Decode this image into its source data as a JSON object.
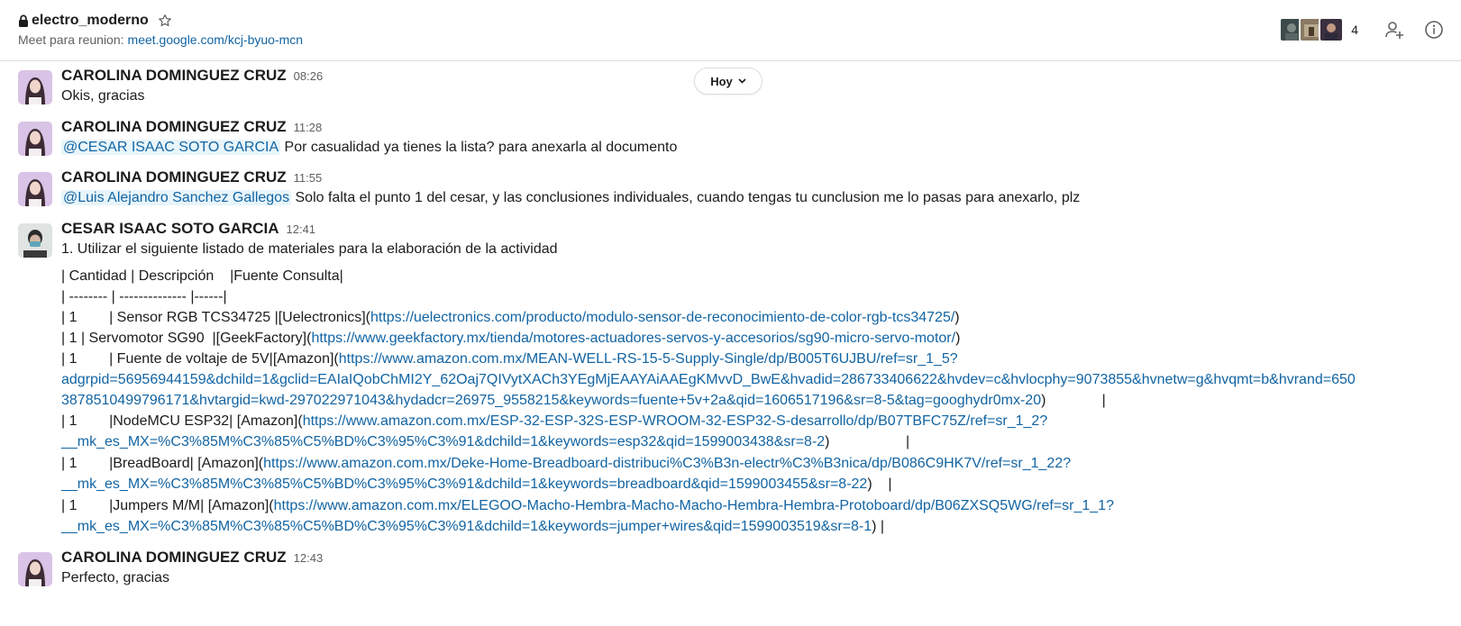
{
  "channel": {
    "name": "electro_moderno",
    "topic_label": "Meet para reunion:",
    "topic_link": "meet.google.com/kcj-byuo-mcn",
    "member_count": "4"
  },
  "day_divider": {
    "label": "Hoy"
  },
  "messages": [
    {
      "author": "CAROLINA DOMINGUEZ CRUZ",
      "time": "08:26",
      "text": "Okis,  gracias"
    },
    {
      "author": "CAROLINA DOMINGUEZ CRUZ",
      "time": "11:28",
      "mention": "@CESAR ISAAC SOTO GARCIA",
      "text": " Por casualidad ya tienes la lista? para anexarla al documento"
    },
    {
      "author": "CAROLINA DOMINGUEZ CRUZ",
      "time": "11:55",
      "mention": "@Luis Alejandro Sanchez Gallegos",
      "text": " Solo falta el punto 1 del cesar, y las conclusiones individuales, cuando tengas tu cunclusion me lo pasas para anexarlo, plz"
    },
    {
      "author": "CESAR ISAAC SOTO GARCIA",
      "time": "12:41",
      "text": "1. Utilizar el siguiente listado de materiales para la elaboración de la actividad"
    },
    {
      "author": "CAROLINA DOMINGUEZ CRUZ",
      "time": "12:43",
      "text": "Perfecto, gracias"
    }
  ],
  "table_lines": [
    {
      "pre": "| Cantidad | Descripción    |Fuente Consulta|"
    },
    {
      "pre": "| -------- | -------------- |------|"
    },
    {
      "pre": "| 1        | Sensor RGB TCS34725 |[Uelectronics](",
      "link": "https://uelectronics.com/producto/modulo-sensor-de-reconocimiento-de-color-rgb-tcs34725/",
      "post": ")"
    },
    {
      "pre": "| 1 | Servomotor SG90  |[GeekFactory](",
      "link": "https://www.geekfactory.mx/tienda/motores-actuadores-servos-y-accesorios/sg90-micro-servo-motor/",
      "post": ")"
    },
    {
      "pre": "| 1        | Fuente de voltaje de 5V|[Amazon](",
      "link": "https://www.amazon.com.mx/MEAN-WELL-RS-15-5-Supply-Single/dp/B005T6UJBU/ref=sr_1_5?"
    },
    {
      "link": "adgrpid=56956944159&dchild=1&gclid=EAIaIQobChMI2Y_62Oaj7QIVytXACh3YEgMjEAAYAiAAEgKMvvD_BwE&hvadid=286733406622&hvdev=c&hvlocphy=9073855&hvnetw=g&hvqmt=b&hvrand=650"
    },
    {
      "link": "3878510499796171&hvtargid=kwd-297022971043&hydadcr=26975_9558215&keywords=fuente+5v+2a&qid=1606517196&sr=8-5&tag=googhydr0mx-20",
      "post": ")              |"
    },
    {
      "pre": "| 1        |NodeMCU ESP32| [Amazon](",
      "link": "https://www.amazon.com.mx/ESP-32-ESP-32S-ESP-WROOM-32-ESP32-S-desarrollo/dp/B07TBFC75Z/ref=sr_1_2?"
    },
    {
      "link": "__mk_es_MX=%C3%85M%C3%85%C5%BD%C3%95%C3%91&dchild=1&keywords=esp32&qid=1599003438&sr=8-2",
      "post": ")                   |"
    },
    {
      "pre": "| 1        |BreadBoard| [Amazon](",
      "link": "https://www.amazon.com.mx/Deke-Home-Breadboard-distribuci%C3%B3n-electr%C3%B3nica/dp/B086C9HK7V/ref=sr_1_22?"
    },
    {
      "link": "__mk_es_MX=%C3%85M%C3%85%C5%BD%C3%95%C3%91&dchild=1&keywords=breadboard&qid=1599003455&sr=8-22",
      "post": ")    |"
    },
    {
      "pre": "| 1        |Jumpers M/M| [Amazon](",
      "link": "https://www.amazon.com.mx/ELEGOO-Macho-Hembra-Macho-Macho-Hembra-Hembra-Protoboard/dp/B06ZXSQ5WG/ref=sr_1_1?"
    },
    {
      "link": "__mk_es_MX=%C3%85M%C3%85%C5%BD%C3%95%C3%91&dchild=1&keywords=jumper+wires&qid=1599003519&sr=8-1",
      "post": ") |"
    }
  ],
  "icons": {
    "lock": "lock-icon",
    "star": "star-icon",
    "add_member": "add-person-icon",
    "info": "info-icon",
    "chevron": "chevron-down-icon"
  },
  "colors": {
    "link": "#1264a3",
    "mention_bg": "#e8f5fa",
    "text": "#1d1c1d",
    "muted": "#616061"
  }
}
